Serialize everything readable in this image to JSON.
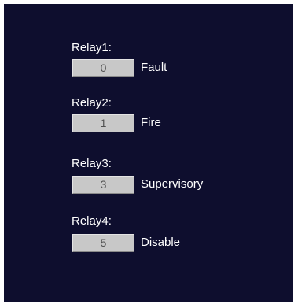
{
  "relays": [
    {
      "label": "Relay1:",
      "value": "0",
      "description": "Fault"
    },
    {
      "label": "Relay2:",
      "value": "1",
      "description": "Fire"
    },
    {
      "label": "Relay3:",
      "value": "3",
      "description": "Supervisory"
    },
    {
      "label": "Relay4:",
      "value": "5",
      "description": "Disable"
    }
  ],
  "colors": {
    "background": "#0e0e2e",
    "field": "#c8c8c8",
    "text": "#ffffff"
  }
}
